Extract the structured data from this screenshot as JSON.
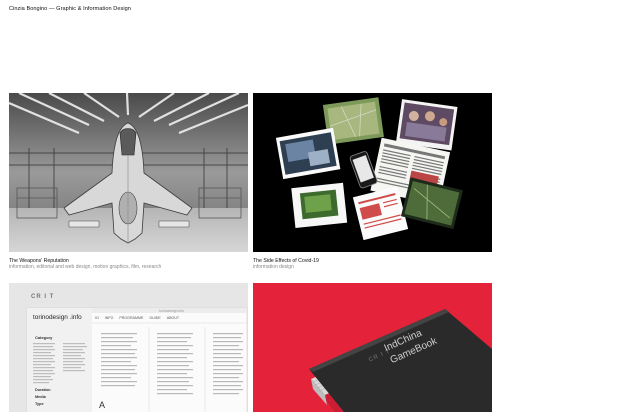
{
  "site": {
    "title": "Cinzia Bongino — Graphic & Information Design"
  },
  "projects": [
    {
      "title": "The Weapons' Reputation",
      "tags": "information, editorial and web design, motion graphics, film, research"
    },
    {
      "title": "The Side Effects of Covid-19",
      "tags": "information design"
    },
    {
      "title": "",
      "tags": "",
      "mock": {
        "logo": "torinodesign .info",
        "brand": "CR I T",
        "nav_items": [
          "IO",
          "INFO",
          "PROGRAMME",
          "GUIDE",
          "ABOUT"
        ],
        "url": "torinodesign.info",
        "sidebar_heading": "Category",
        "sidebar_footer": [
          "Duration",
          "Media",
          "Type"
        ],
        "big_letter": "A"
      }
    },
    {
      "title": "",
      "tags": "",
      "book": {
        "brand": "CR I T",
        "title_line1": "IndChina",
        "title_line2": "GameBook"
      }
    }
  ],
  "colors": {
    "book_background": "#e4233a",
    "book_cover": "#2a2a2a",
    "dark_panel": "#000000"
  }
}
